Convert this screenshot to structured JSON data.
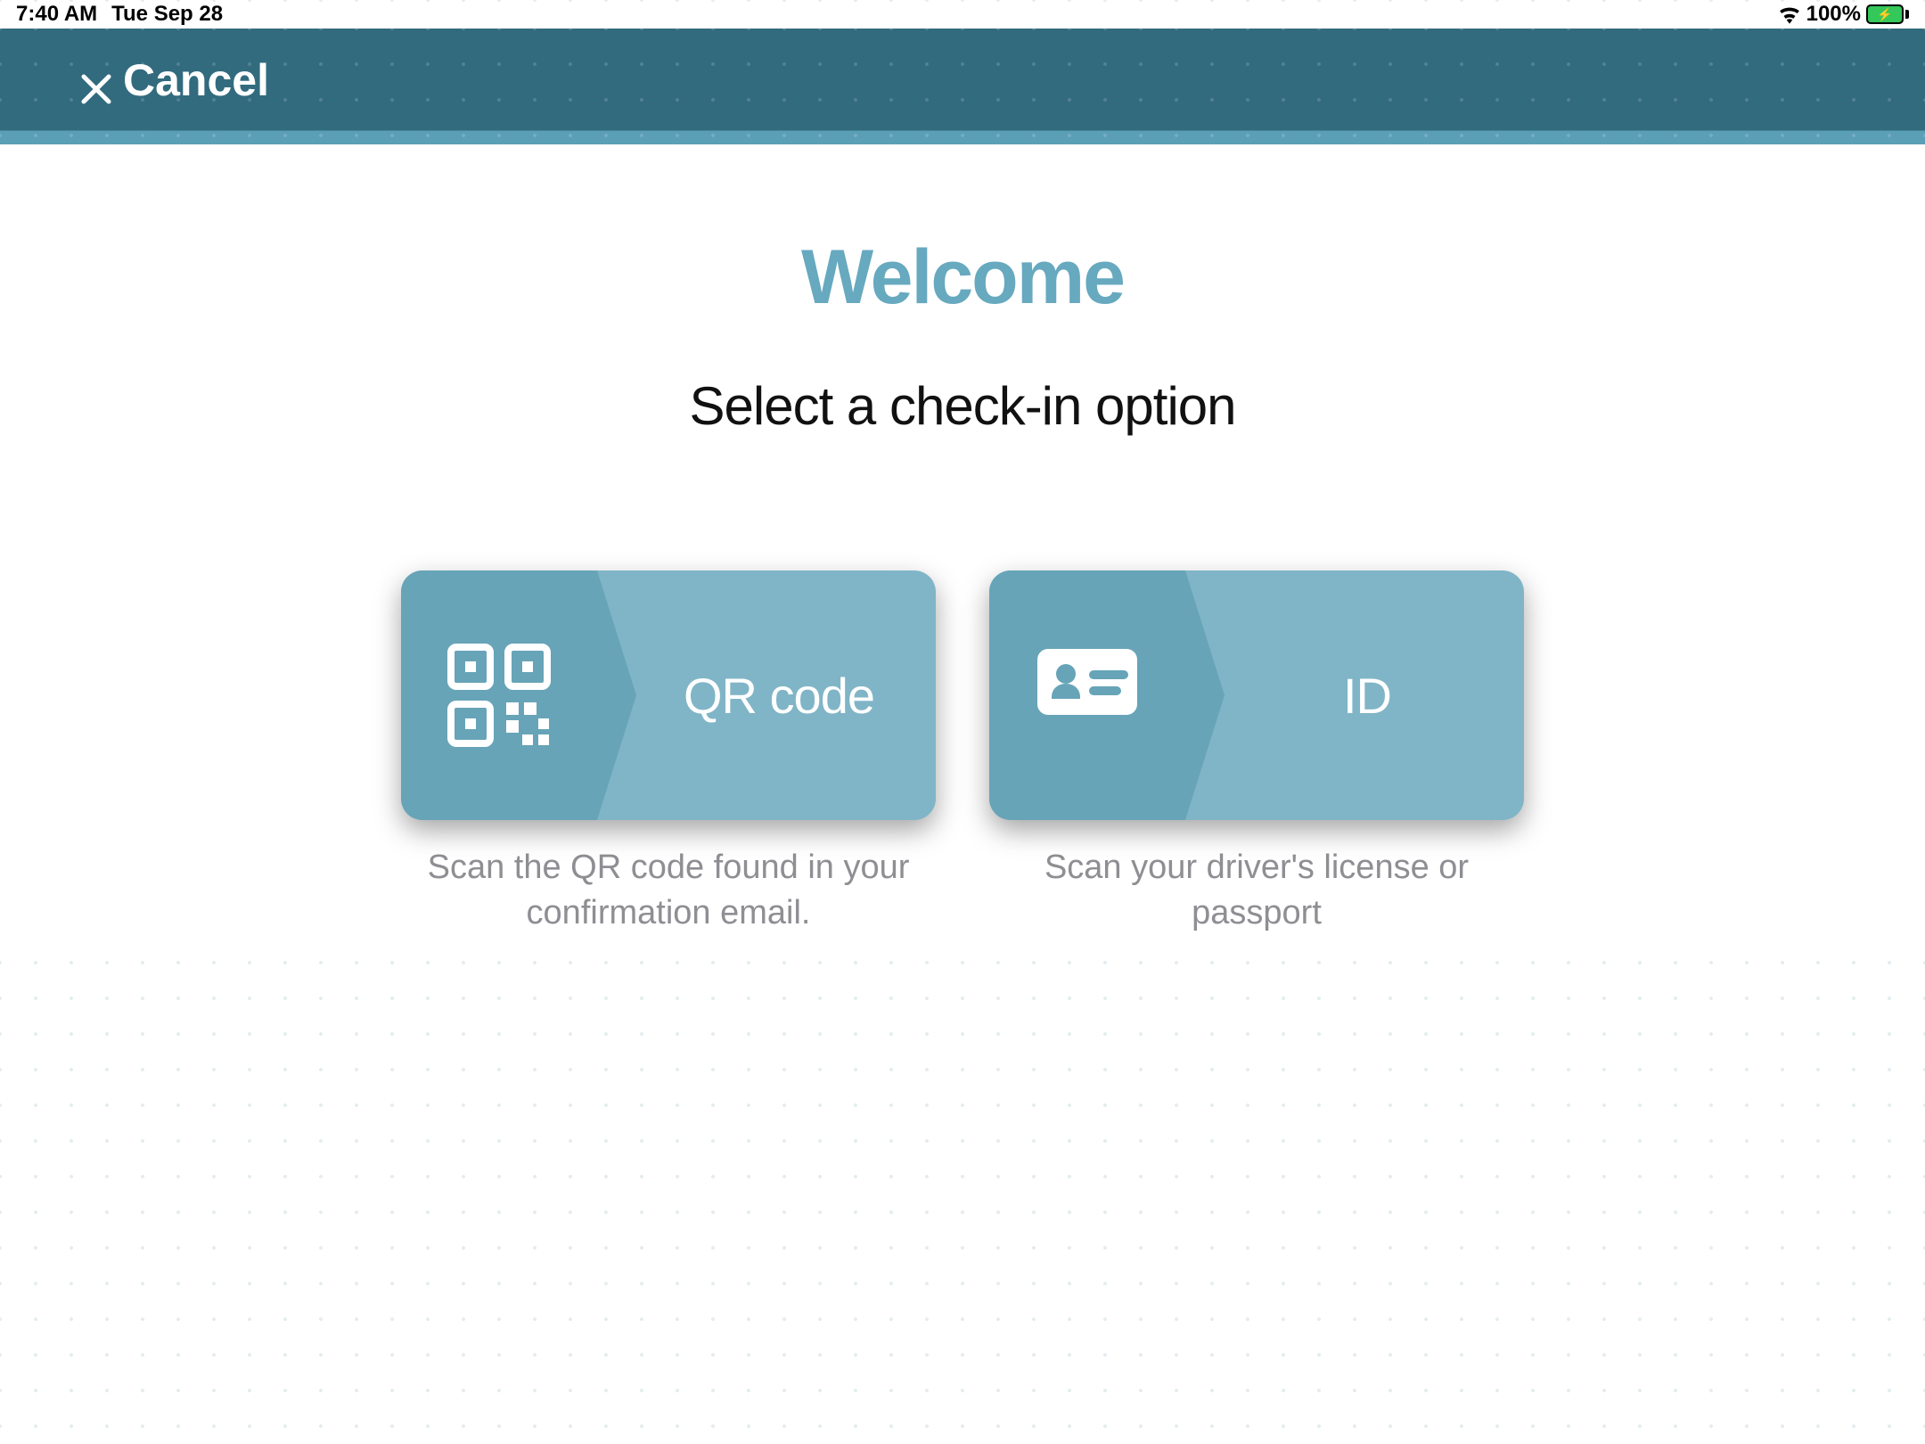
{
  "status": {
    "time": "7:40 AM",
    "date": "Tue Sep 28",
    "battery_pct": "100%"
  },
  "header": {
    "cancel_label": "Cancel"
  },
  "main": {
    "title": "Welcome",
    "subtitle": "Select a check-in option"
  },
  "options": {
    "qr": {
      "label": "QR code",
      "desc": "Scan the QR code found in your confirmation email."
    },
    "id": {
      "label": "ID",
      "desc": "Scan your driver's license or passport"
    }
  }
}
